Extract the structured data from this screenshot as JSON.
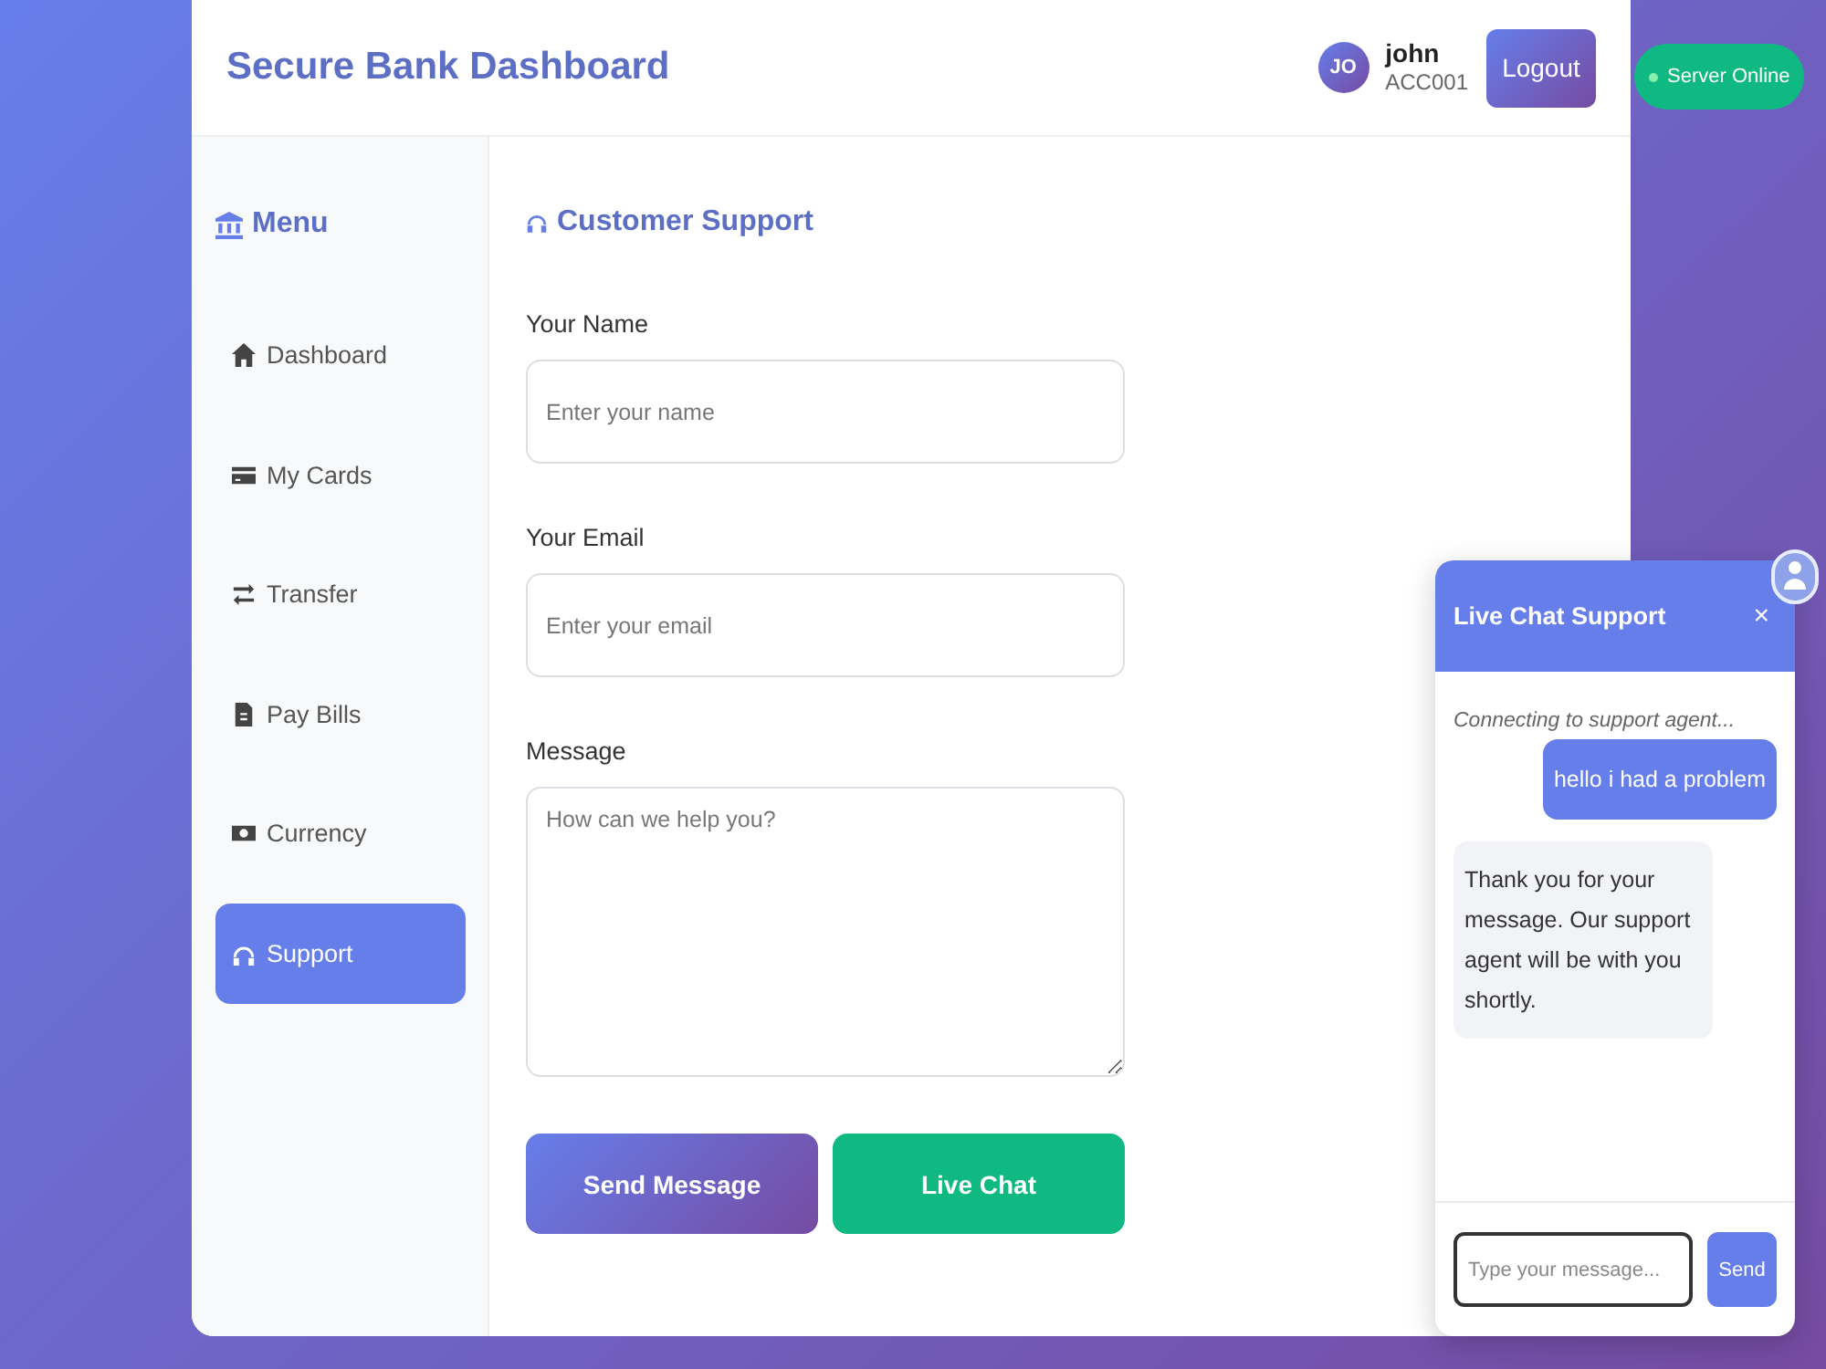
{
  "header": {
    "title": "Secure Bank Dashboard",
    "user": {
      "initials": "JO",
      "name": "john",
      "account": "ACC001"
    },
    "logout": "Logout"
  },
  "server_status": {
    "label": "Server Online",
    "online": true
  },
  "sidebar": {
    "title": "Menu",
    "items": [
      {
        "label": "Dashboard",
        "selected": false
      },
      {
        "label": "My Cards",
        "selected": false
      },
      {
        "label": "Transfer",
        "selected": false
      },
      {
        "label": "Pay Bills",
        "selected": false
      },
      {
        "label": "Currency",
        "selected": false
      },
      {
        "label": "Support",
        "selected": true
      }
    ]
  },
  "support_form": {
    "title": "Customer Support",
    "fields": [
      {
        "kind": "input",
        "label": "Your Name",
        "placeholder": "Enter your name"
      },
      {
        "kind": "input",
        "label": "Your Email",
        "placeholder": "Enter your email"
      },
      {
        "kind": "textarea",
        "label": "Message",
        "placeholder": "How can we help you?"
      }
    ],
    "buttons": [
      {
        "kind": "primary",
        "label": "Send Message"
      },
      {
        "kind": "success",
        "label": "Live Chat"
      }
    ]
  },
  "chat": {
    "title": "Live Chat Support",
    "close": "×",
    "messages": [
      {
        "kind": "system",
        "text": "Connecting to support agent..."
      },
      {
        "kind": "user",
        "text": "hello i had a problem"
      },
      {
        "kind": "agent",
        "text": "Thank you for your message. Our support agent will be with you shortly."
      }
    ],
    "input": {
      "placeholder": "Type your message...",
      "focused": true
    },
    "send": "Send"
  }
}
